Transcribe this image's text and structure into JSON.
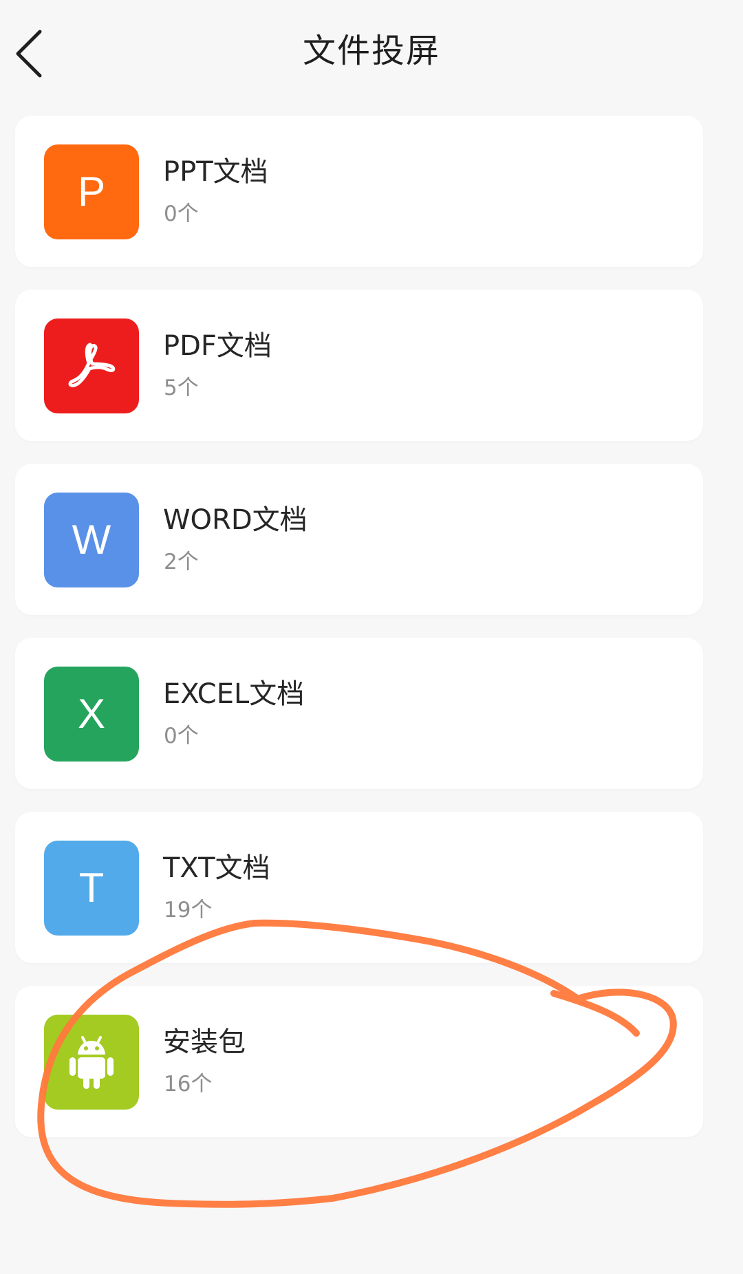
{
  "header": {
    "title": "文件投屏",
    "back_icon": "chevron-left-icon"
  },
  "items": [
    {
      "title": "PPT文档",
      "count": "0个",
      "icon": "ppt-icon",
      "icon_text": "P",
      "color": "#ff6a10"
    },
    {
      "title": "PDF文档",
      "count": "5个",
      "icon": "pdf-icon",
      "icon_text": "",
      "color": "#ee1d1d"
    },
    {
      "title": "WORD文档",
      "count": "2个",
      "icon": "word-icon",
      "icon_text": "W",
      "color": "#5a91e8"
    },
    {
      "title": "EXCEL文档",
      "count": "0个",
      "icon": "excel-icon",
      "icon_text": "X",
      "color": "#24a45d"
    },
    {
      "title": "TXT文档",
      "count": "19个",
      "icon": "txt-icon",
      "icon_text": "T",
      "color": "#52aaea"
    },
    {
      "title": "安装包",
      "count": "16个",
      "icon": "android-icon",
      "icon_text": "",
      "color": "#a3cb22"
    }
  ],
  "annotation": {
    "type": "hand-drawn-ellipse",
    "color": "#ff7a3d",
    "target": "安装包"
  }
}
